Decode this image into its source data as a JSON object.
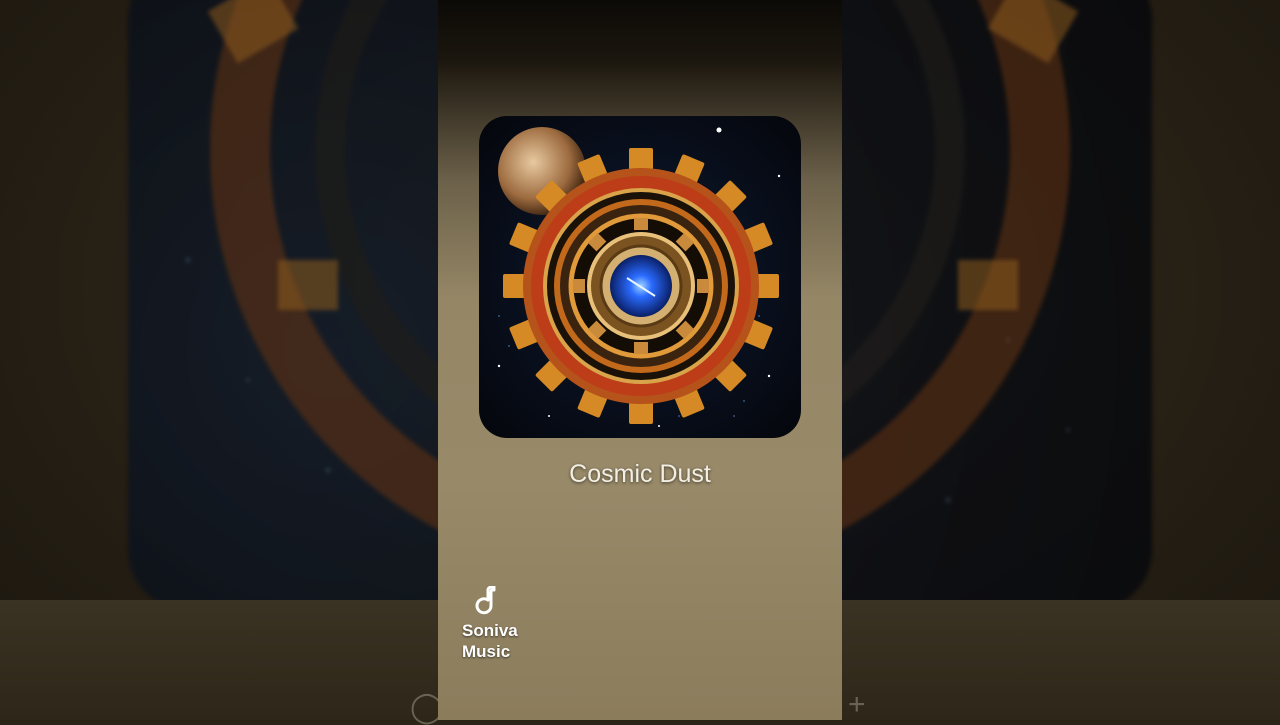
{
  "track": {
    "title": "Cosmic Dust"
  },
  "brand": {
    "name": "Soniva\nMusic",
    "icon": "music-note-icon"
  },
  "cover": {
    "icon": "gear-artwork",
    "colors": {
      "gear": "#d2801d",
      "rust": "#b23a12",
      "core": "#1b4fd6",
      "space": "#05070d"
    }
  },
  "edge_icons": [
    "circle-icon",
    "plus-icon"
  ]
}
